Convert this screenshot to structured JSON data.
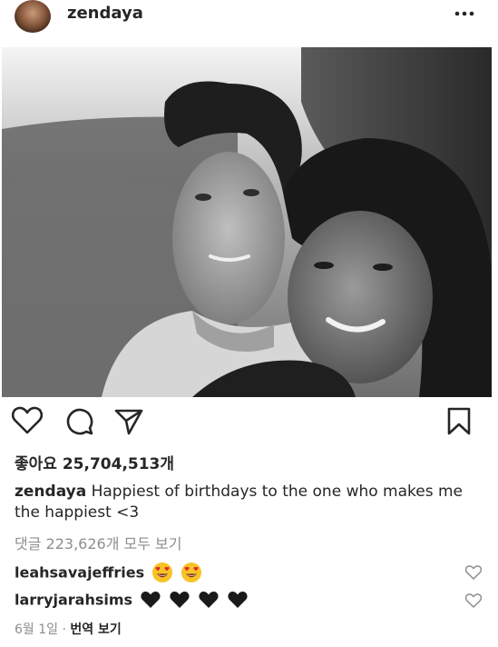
{
  "header": {
    "username": "zendaya",
    "more_icon": "more-horizontal-icon"
  },
  "post": {
    "image_alt": "black-and-white photo of two people smiling cheek to cheek outdoors"
  },
  "actions": {
    "icons": [
      "heart-icon",
      "comment-icon",
      "share-icon",
      "bookmark-icon"
    ]
  },
  "likes": {
    "label": "좋아요",
    "count": "25,704,513개"
  },
  "caption": {
    "username": "zendaya",
    "text": "Happiest of birthdays to the one who makes me the happiest <3"
  },
  "comments_link": {
    "text": "댓글 223,626개 모두 보기"
  },
  "comments": [
    {
      "username": "leahsavajeffries",
      "emoji": [
        "heart-eyes-emoji",
        "heart-eyes-emoji"
      ]
    },
    {
      "username": "larryjarahsims",
      "emoji": [
        "black-heart-emoji",
        "black-heart-emoji",
        "black-heart-emoji",
        "black-heart-emoji"
      ]
    }
  ],
  "meta": {
    "date": "6월 1일",
    "separator": "·",
    "translate": "번역 보기"
  },
  "colors": {
    "text": "#262626",
    "secondary": "#8e8e8e",
    "background": "#ffffff"
  }
}
